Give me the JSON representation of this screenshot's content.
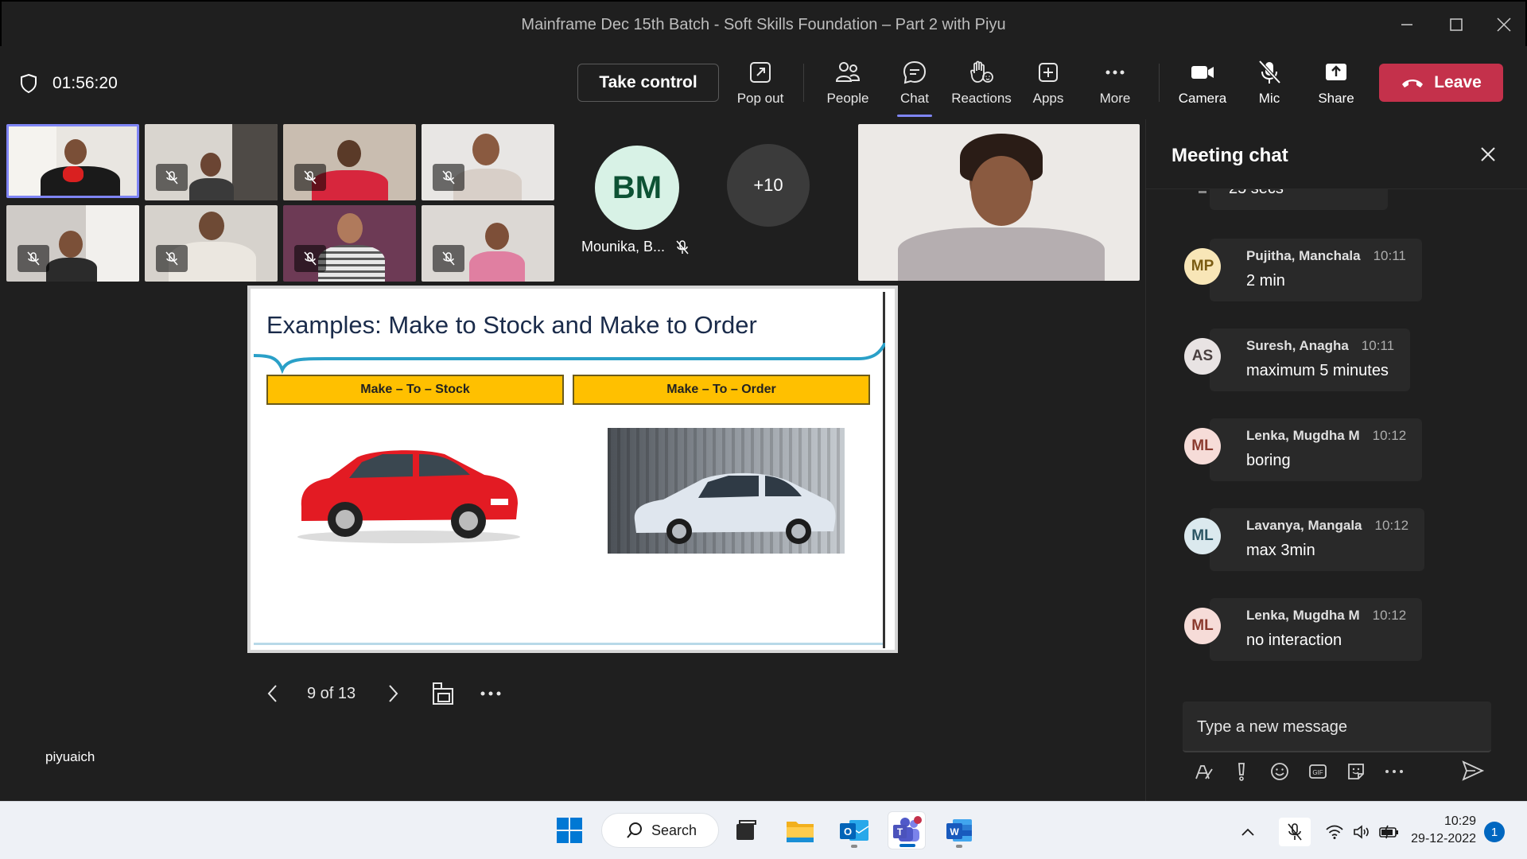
{
  "window": {
    "title": "Mainframe Dec 15th Batch - Soft Skills Foundation – Part 2 with Piyu"
  },
  "toolbar": {
    "timer": "01:56:20",
    "take_control": "Take control",
    "pop_out": "Pop out",
    "people": "People",
    "chat": "Chat",
    "reactions": "Reactions",
    "apps": "Apps",
    "more": "More",
    "camera": "Camera",
    "mic": "Mic",
    "share": "Share",
    "leave": "Leave"
  },
  "participants": {
    "avatar_initials": "BM",
    "avatar_name": "Mounika, B...",
    "overflow_count": "+10"
  },
  "slide": {
    "title": "Examples: Make to Stock and Make to Order",
    "box_left": "Make – To – Stock",
    "box_right": "Make – To – Order",
    "page_indicator": "9 of 13"
  },
  "presenter": {
    "name": "piyuaich"
  },
  "chat": {
    "title": "Meeting chat",
    "truncated_text": "25 secs",
    "messages": [
      {
        "initials": "MP",
        "sender": "Pujitha, Manchala",
        "time": "10:11",
        "text": "2 min",
        "avatar_bg": "#f8e6b7",
        "avatar_fg": "#7a5b12"
      },
      {
        "initials": "AS",
        "sender": "Suresh, Anagha",
        "time": "10:11",
        "text": "maximum 5 minutes",
        "avatar_bg": "#e8e3e3",
        "avatar_fg": "#4a4040"
      },
      {
        "initials": "ML",
        "sender": "Lenka, Mugdha M",
        "time": "10:12",
        "text": "boring",
        "avatar_bg": "#f6dcd8",
        "avatar_fg": "#8a3a2e"
      },
      {
        "initials": "ML",
        "sender": "Lavanya, Mangala",
        "time": "10:12",
        "text": "max 3min",
        "avatar_bg": "#dbe9ee",
        "avatar_fg": "#2b5563"
      },
      {
        "initials": "ML",
        "sender": "Lenka, Mugdha M",
        "time": "10:12",
        "text": "no interaction",
        "avatar_bg": "#f6dcd8",
        "avatar_fg": "#8a3a2e"
      }
    ],
    "compose_placeholder": "Type a new message"
  },
  "taskbar": {
    "search_label": "Search",
    "time": "10:29",
    "date": "29-12-2022",
    "notification_count": "1"
  },
  "colors": {
    "leave_red": "#c4314b",
    "accent_purple": "#7f85f5",
    "slide_box_yellow": "#ffc000"
  }
}
